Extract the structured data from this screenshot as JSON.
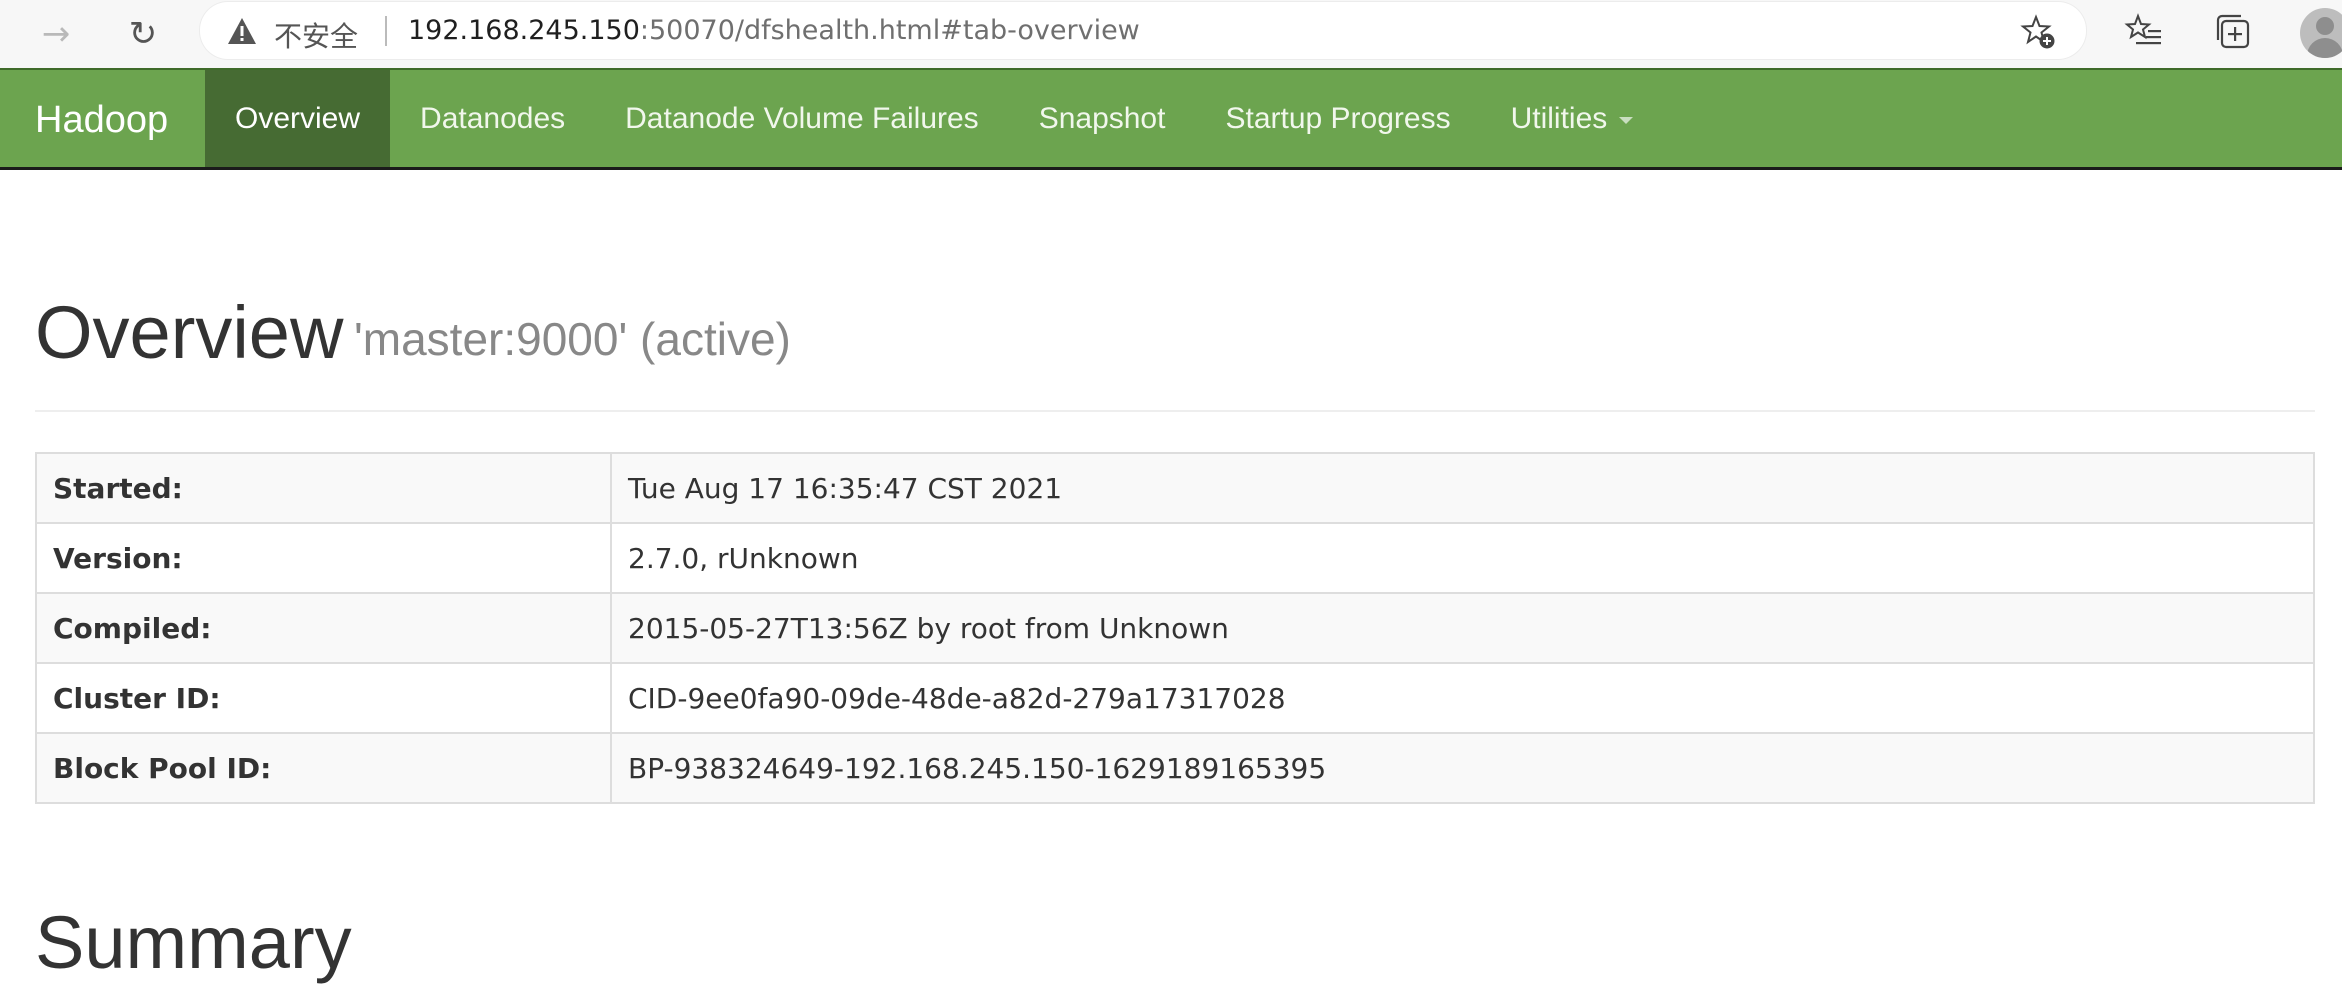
{
  "browser": {
    "security_label": "不安全",
    "url_host": "192.168.245.150",
    "url_rest": ":50070/dfshealth.html#tab-overview"
  },
  "navbar": {
    "brand": "Hadoop",
    "items": [
      {
        "label": "Overview",
        "active": true
      },
      {
        "label": "Datanodes"
      },
      {
        "label": "Datanode Volume Failures"
      },
      {
        "label": "Snapshot"
      },
      {
        "label": "Startup Progress"
      },
      {
        "label": "Utilities"
      }
    ],
    "color": "#6ca44f",
    "active_color": "#466b33"
  },
  "header": {
    "title": "Overview",
    "subtitle": "'master:9000' (active)"
  },
  "info_table": {
    "rows": [
      {
        "label": "Started:",
        "value": "Tue Aug 17 16:35:47 CST 2021"
      },
      {
        "label": "Version:",
        "value": "2.7.0, rUnknown"
      },
      {
        "label": "Compiled:",
        "value": "2015-05-27T13:56Z by root from Unknown"
      },
      {
        "label": "Cluster ID:",
        "value": "CID-9ee0fa90-09de-48de-a82d-279a17317028"
      },
      {
        "label": "Block Pool ID:",
        "value": "BP-938324649-192.168.245.150-1629189165395"
      }
    ]
  },
  "summary": {
    "title": "Summary"
  },
  "icons": {
    "back": "arrow-left-icon",
    "reload": "refresh-icon",
    "warning": "warning-triangle-icon",
    "add_favorite": "star-add-icon",
    "favorites": "favorites-list-icon",
    "collections": "collections-icon",
    "profile": "profile-avatar-icon"
  }
}
